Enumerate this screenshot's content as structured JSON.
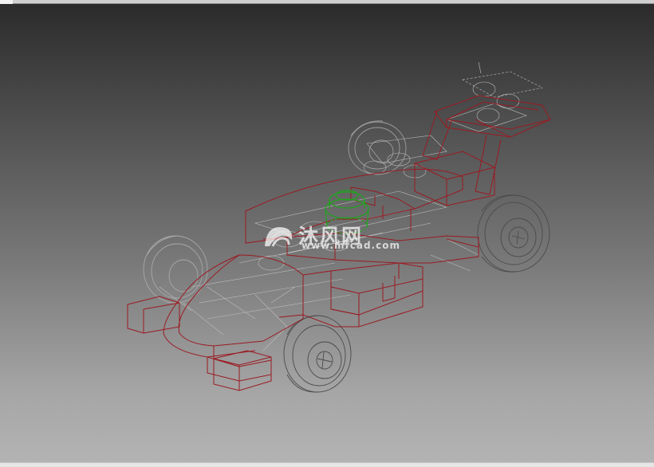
{
  "viewport": {
    "content": "wireframe 3D model of a toy race car",
    "colors": {
      "edges_red": "#9a1b22",
      "edges_grey": "#b9b9b9",
      "edges_dark": "#4b4b4b",
      "highlight_green": "#1fa51f"
    }
  },
  "watermark": {
    "cn_text": "沐风网",
    "url_text": "www.mfcad.com",
    "logo_icon": "mfcad-logo-icon"
  }
}
